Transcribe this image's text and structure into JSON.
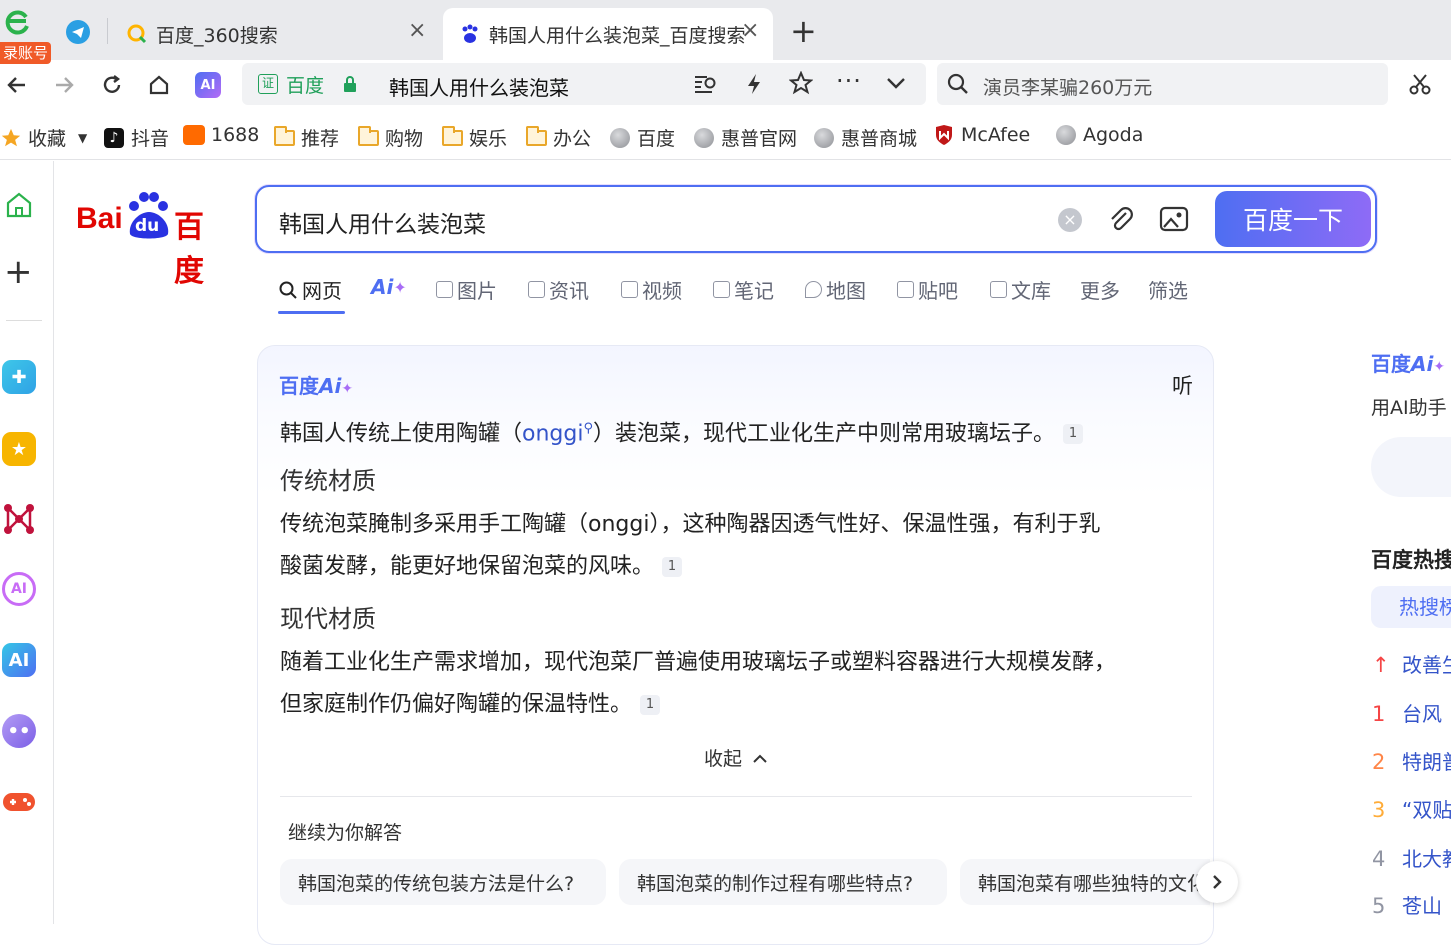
{
  "browser": {
    "account_badge": "录账号",
    "tabs": [
      {
        "title": "百度_360搜索",
        "active": false
      },
      {
        "title": "韩国人用什么装泡菜_百度搜索",
        "active": true
      }
    ],
    "new_tab_symbol": "+",
    "address": {
      "cert_label": "证",
      "site_label": "百度",
      "url_text": "韩国人用什么装泡菜"
    },
    "search_box": {
      "value": "演员李某骗260万元"
    },
    "bookmarks": [
      "收藏",
      "抖音",
      "1688",
      "推荐",
      "购物",
      "娱乐",
      "办公",
      "百度",
      "惠普官网",
      "惠普商城",
      "McAfee",
      "Agoda"
    ]
  },
  "baidu": {
    "logo": {
      "left": "Bai",
      "mid": "du",
      "right": "百度"
    },
    "query": "韩国人用什么装泡菜",
    "search_button": "百度一下",
    "vertical_tabs": [
      "网页",
      "Ai",
      "图片",
      "资讯",
      "视频",
      "笔记",
      "地图",
      "贴吧",
      "文库",
      "更多",
      "筛选"
    ],
    "ai_card": {
      "brand": "百度",
      "brand_ai": "Ai",
      "listen": "听",
      "intro_before": "韩国人传统上使用陶罐（",
      "intro_link": "onggi",
      "intro_after": "）装泡菜，现代工业化生产中则常用玻璃坛子。",
      "sections": [
        {
          "heading": "传统材质",
          "lines": [
            "传统泡菜腌制多采用手工陶罐（onggi），这种陶器因透气性好、保温性强，有利于乳",
            "酸菌发酵，能更好地保留泡菜的风味。"
          ]
        },
        {
          "heading": "现代材质",
          "lines": [
            "随着工业化生产需求增加，现代泡菜厂普遍使用玻璃坛子或塑料容器进行大规模发酵，",
            "但家庭制作仍偏好陶罐的保温特性。"
          ]
        }
      ],
      "cite": "1",
      "collapse": "收起",
      "followup_title": "继续为你解答",
      "followups": [
        "韩国泡菜的传统包装方法是什么?",
        "韩国泡菜的制作过程有哪些特点?",
        "韩国泡菜有哪些独特的文化"
      ]
    },
    "right": {
      "ai_brand": "百度",
      "ai_brand_ai": "Ai",
      "ai_sub": "用AI助手",
      "hot_title": "百度热搜",
      "hot_tab": "热搜榜",
      "hot_list": [
        {
          "rank": "↑",
          "text": "改善生",
          "color": "#f54545"
        },
        {
          "rank": "1",
          "text": "台风",
          "color": "#f54545"
        },
        {
          "rank": "2",
          "text": "特朗普",
          "color": "#ff8547"
        },
        {
          "rank": "3",
          "text": "“双贴",
          "color": "#ffac38"
        },
        {
          "rank": "4",
          "text": "北大教",
          "color": "#9195a3"
        },
        {
          "rank": "5",
          "text": "苍山",
          "color": "#9195a3"
        }
      ]
    }
  }
}
